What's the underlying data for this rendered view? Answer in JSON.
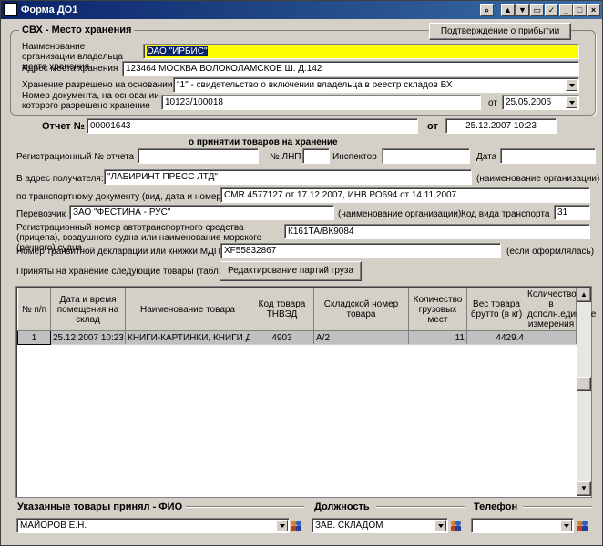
{
  "window": {
    "title": "Форма ДО1"
  },
  "svh": {
    "group_title": "СВХ - Место хранения",
    "confirm_button": "Подтверждение о прибытии",
    "org_label": "Наименование организации владельца места хранения",
    "org_value": "ОАО \"ИРБИС\"",
    "address_label": "Адрес места хранения",
    "address_value": "123464 МОСКВА ВОЛОКОЛАМСКОЕ Ш. Д.142",
    "basis_label": "Хранение разрешено на основании",
    "basis_value": "\"1\" - свидетельство о включении владельца в реестр складов ВХ",
    "docnum_label": "Номер документа, на основании которого разрешено хранение",
    "docnum_value": "10123/100018",
    "from_label": "от",
    "docdate_value": "25.05.2006"
  },
  "report": {
    "label": "Отчет №",
    "number": "00001643",
    "from_label": "от",
    "date": "25.12.2007 10:23",
    "subtitle": "о принятии товаров на хранение",
    "regnum_label": "Регистрационный № отчета",
    "regnum_value": "",
    "lnp_label": "№ ЛНП",
    "lnp_value": "",
    "inspector_label": "Инспектор",
    "inspector_value": "",
    "date_label": "Дата",
    "date_value": ""
  },
  "receiver": {
    "label": "В адрес получателя:",
    "value": "\"ЛАБИРИНТ ПРЕСС ЛТД\"",
    "hint": "(наименование организации)"
  },
  "transport_doc": {
    "label": "по транспортному документу (вид, дата и номер)",
    "value": "CMR 4577127 от 17.12.2007,  ИНВ РО694 от 14.11.2007"
  },
  "carrier": {
    "label": "Перевозчик",
    "value": "ЗАО \"ФЕСТИНА - РУС\"",
    "hint": "(наименование организации)",
    "transport_code_label": "Код вида транспорта",
    "transport_code_value": "31"
  },
  "vehicle": {
    "label": "Регистрационный номер автотранспортного средства (прицепа), воздушного судна или наименование морского (речного) судна",
    "value": "К161ТА/ВК9084"
  },
  "transit": {
    "label": "Номер транзитной декларации или книжки МДП",
    "value": "XF55832867",
    "hint": "(если оформлялась)"
  },
  "goods": {
    "label": "Приняты на хранение следующие товары (табл.)",
    "edit_button": "Редактирование партий груза"
  },
  "table": {
    "headers": [
      "№ п/п",
      "Дата и время помещения на склад",
      "Наименование товара",
      "Код товара ТНВЭД",
      "Складской номер товара",
      "Количество грузовых мест",
      "Вес товара брутто (в кг)",
      "Количество в дополн.единице измерения"
    ],
    "rows": [
      [
        "1",
        "25.12.2007 10:23",
        "КНИГИ-КАРТИНКИ, КНИГИ Д",
        "4903",
        "A/2",
        "11",
        "4429.4",
        ""
      ]
    ]
  },
  "footer": {
    "accepted_title": "Указанные товары принял - ФИО",
    "accepted_value": "МАЙОРОВ Е.Н.",
    "position_title": "Должность",
    "position_value": "ЗАВ. СКЛАДОМ",
    "phone_title": "Телефон",
    "phone_value": ""
  }
}
